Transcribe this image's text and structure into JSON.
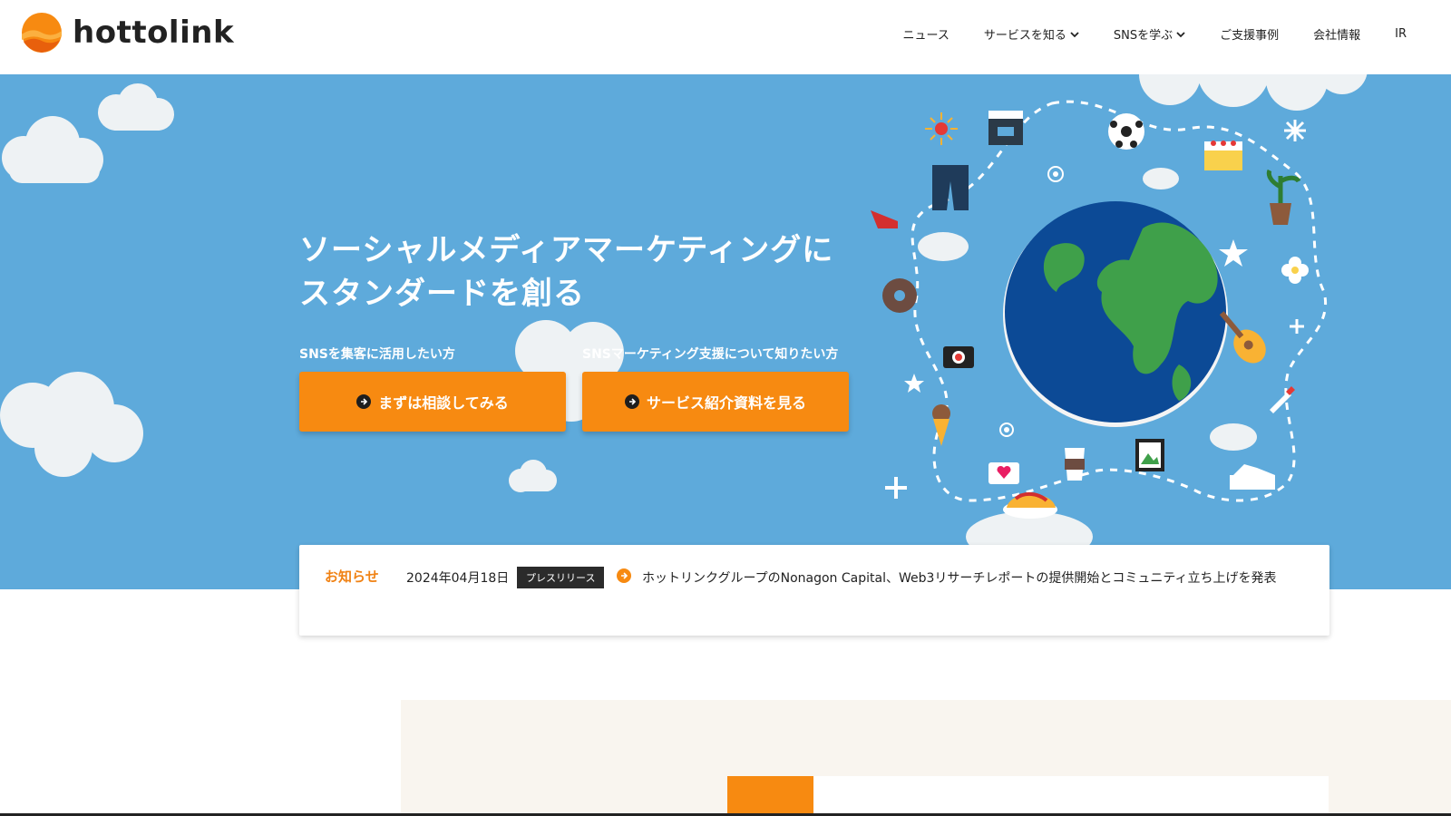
{
  "brand": {
    "name": "hottolink",
    "logo_icon": "hottolink-logo-icon",
    "accent": "#f78a11",
    "hero_bg": "#5eaadb"
  },
  "nav": {
    "items": [
      {
        "label": "ニュース",
        "dropdown": false
      },
      {
        "label": "サービスを知る",
        "dropdown": true
      },
      {
        "label": "SNSを学ぶ",
        "dropdown": true
      },
      {
        "label": "ご支援事例",
        "dropdown": false
      },
      {
        "label": "会社情報",
        "dropdown": false
      },
      {
        "label": "IR",
        "dropdown": false
      }
    ]
  },
  "hero": {
    "headline_line1": "ソーシャルメディアマーケティングに",
    "headline_line2": "スタンダードを創る",
    "cta": [
      {
        "caption": "SNSを集客に活用したい方",
        "button": "まずは相談してみる"
      },
      {
        "caption": "SNSマーケティング支援について知りたい方",
        "button": "サービス紹介資料を見る"
      }
    ],
    "illustration": "globe-with-lifestyle-icons"
  },
  "news": {
    "label": "お知らせ",
    "date": "2024年04月18日",
    "tag": "プレスリリース",
    "headline": "ホットリンクグループのNonagon Capital、Web3リサーチレポートの提供開始とコミュニティ立ち上げを発表"
  }
}
